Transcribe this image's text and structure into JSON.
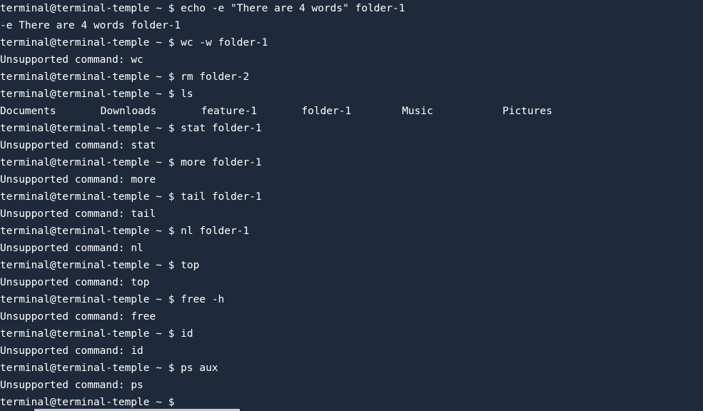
{
  "prompt": "terminal@terminal-temple ~ $",
  "history": [
    {
      "command": "echo -e \"There are 4 words\" folder-1",
      "output": [
        "-e There are 4 words folder-1"
      ]
    },
    {
      "command": "wc -w folder-1",
      "output": [
        "Unsupported command: wc"
      ]
    },
    {
      "command": "rm folder-2",
      "output": []
    },
    {
      "command": "ls",
      "ls_items": [
        "Documents",
        "Downloads",
        "feature-1",
        "folder-1",
        "Music",
        "Pictures"
      ]
    },
    {
      "command": "stat folder-1",
      "output": [
        "Unsupported command: stat"
      ]
    },
    {
      "command": "more folder-1",
      "output": [
        "Unsupported command: more"
      ]
    },
    {
      "command": "tail folder-1",
      "output": [
        "Unsupported command: tail"
      ]
    },
    {
      "command": "nl folder-1",
      "output": [
        "Unsupported command: nl"
      ]
    },
    {
      "command": "top",
      "output": [
        "Unsupported command: top"
      ]
    },
    {
      "command": "free -h",
      "output": [
        "Unsupported command: free"
      ]
    },
    {
      "command": "id",
      "output": [
        "Unsupported command: id"
      ]
    },
    {
      "command": "ps aux",
      "output": [
        "Unsupported command: ps"
      ]
    }
  ],
  "current_input": "",
  "colors": {
    "background": "#1e2a3b",
    "text": "#ffffff",
    "scrollbar": "#c9ced6"
  }
}
